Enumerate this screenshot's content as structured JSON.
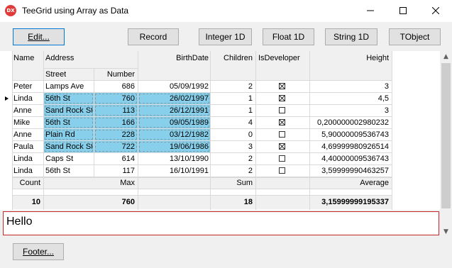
{
  "window": {
    "title": "TeeGrid using Array as Data",
    "icon_text": "DX"
  },
  "toolbar": {
    "edit": "Edit...",
    "record": "Record",
    "integer": "Integer 1D",
    "float": "Float 1D",
    "string": "String 1D",
    "tobject": "TObject"
  },
  "grid": {
    "headers": {
      "name": "Name",
      "address": "Address",
      "street": "Street",
      "number": "Number",
      "birthdate": "BirthDate",
      "children": "Children",
      "isdeveloper": "IsDeveloper",
      "height": "Height"
    },
    "rows": [
      {
        "name": "Peter",
        "street": "Lamps Ave",
        "number": "686",
        "birthdate": "05/09/1992",
        "children": "2",
        "isdeveloper": true,
        "height": "3",
        "selected": false
      },
      {
        "name": "Linda",
        "street": "56th St",
        "number": "760",
        "birthdate": "26/02/1997",
        "children": "1",
        "isdeveloper": true,
        "height": "4,5",
        "selected": true
      },
      {
        "name": "Anne",
        "street": "Sand Rock St",
        "number": "113",
        "birthdate": "26/12/1991",
        "children": "1",
        "isdeveloper": false,
        "height": "3",
        "selected": true
      },
      {
        "name": "Mike",
        "street": "56th St",
        "number": "166",
        "birthdate": "09/05/1989",
        "children": "4",
        "isdeveloper": true,
        "height": "0,200000002980232",
        "selected": true
      },
      {
        "name": "Anne",
        "street": "Plain Rd",
        "number": "228",
        "birthdate": "03/12/1982",
        "children": "0",
        "isdeveloper": false,
        "height": "5,90000009536743",
        "selected": true
      },
      {
        "name": "Paula",
        "street": "Sand Rock St",
        "number": "722",
        "birthdate": "19/06/1986",
        "children": "3",
        "isdeveloper": true,
        "height": "4,69999980926514",
        "selected": true
      },
      {
        "name": "Linda",
        "street": "Caps St",
        "number": "614",
        "birthdate": "13/10/1990",
        "children": "2",
        "isdeveloper": false,
        "height": "4,40000009536743",
        "selected": false
      },
      {
        "name": "Linda",
        "street": "56th St",
        "number": "117",
        "birthdate": "16/10/1991",
        "children": "2",
        "isdeveloper": false,
        "height": "3,59999990463257",
        "selected": false
      }
    ],
    "current_row": 1,
    "totals": {
      "labels": {
        "name": "Count",
        "number": "Max",
        "children": "Sum",
        "height": "Average"
      },
      "values": {
        "name": "10",
        "number": "760",
        "children": "18",
        "height": "3,15999999195337"
      }
    }
  },
  "memo": {
    "text": "Hello"
  },
  "footer": {
    "button": "Footer..."
  },
  "colors": {
    "selection": "#87cfea",
    "memo_border": "#c62828",
    "header_bg": "#f0f0f0"
  }
}
